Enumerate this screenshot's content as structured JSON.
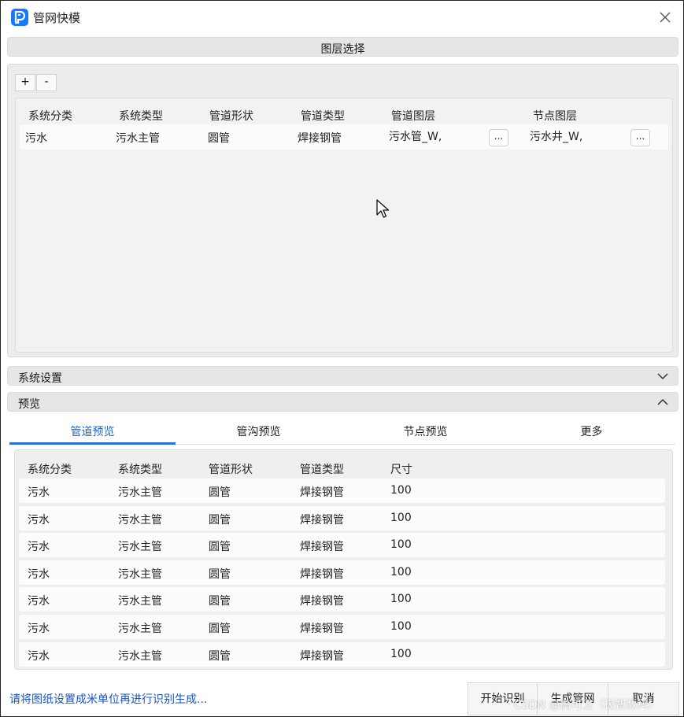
{
  "window": {
    "title": "管网快模",
    "app_icon": "app-logo-icon",
    "close_icon": "close-icon"
  },
  "layer_section": {
    "title": "图层选择",
    "add_label": "+",
    "remove_label": "-",
    "columns": [
      "系统分类",
      "系统类型",
      "管道形状",
      "管道类型",
      "管道图层",
      "节点图层"
    ],
    "rows": [
      {
        "category": "污水",
        "system_type": "污水主管",
        "pipe_shape": "圆管",
        "pipe_type": "焊接钢管",
        "pipe_layer": "污水管_W,",
        "pipe_layer_btn": "...",
        "node_layer": "污水井_W,",
        "node_layer_btn": "..."
      }
    ]
  },
  "system_settings": {
    "title": "系统设置",
    "expanded": false,
    "icon": "chevron-down-icon"
  },
  "preview_section": {
    "title": "预览",
    "expanded": true,
    "icon": "chevron-up-icon",
    "tabs": [
      {
        "label": "管道预览",
        "active": true
      },
      {
        "label": "管沟预览",
        "active": false
      },
      {
        "label": "节点预览",
        "active": false
      },
      {
        "label": "更多",
        "active": false
      }
    ],
    "columns": [
      "系统分类",
      "系统类型",
      "管道形状",
      "管道类型",
      "尺寸"
    ],
    "rows": [
      [
        "污水",
        "污水主管",
        "圆管",
        "焊接钢管",
        "100"
      ],
      [
        "污水",
        "污水主管",
        "圆管",
        "焊接钢管",
        "100"
      ],
      [
        "污水",
        "污水主管",
        "圆管",
        "焊接钢管",
        "100"
      ],
      [
        "污水",
        "污水主管",
        "圆管",
        "焊接钢管",
        "100"
      ],
      [
        "污水",
        "污水主管",
        "圆管",
        "焊接钢管",
        "100"
      ],
      [
        "污水",
        "污水主管",
        "圆管",
        "焊接钢管",
        "100"
      ],
      [
        "污水",
        "污水主管",
        "圆管",
        "焊接钢管",
        "100"
      ]
    ]
  },
  "footer": {
    "message": "请将图纸设置成米单位再进行识别生成...",
    "buttons": [
      "开始识别",
      "生成管网",
      "取消"
    ],
    "watermark": "CSDN @高可卫（极智数科）"
  },
  "colors": {
    "accent": "#2a6fe0",
    "link": "#1a56c8",
    "panel_bg": "#ececec"
  }
}
